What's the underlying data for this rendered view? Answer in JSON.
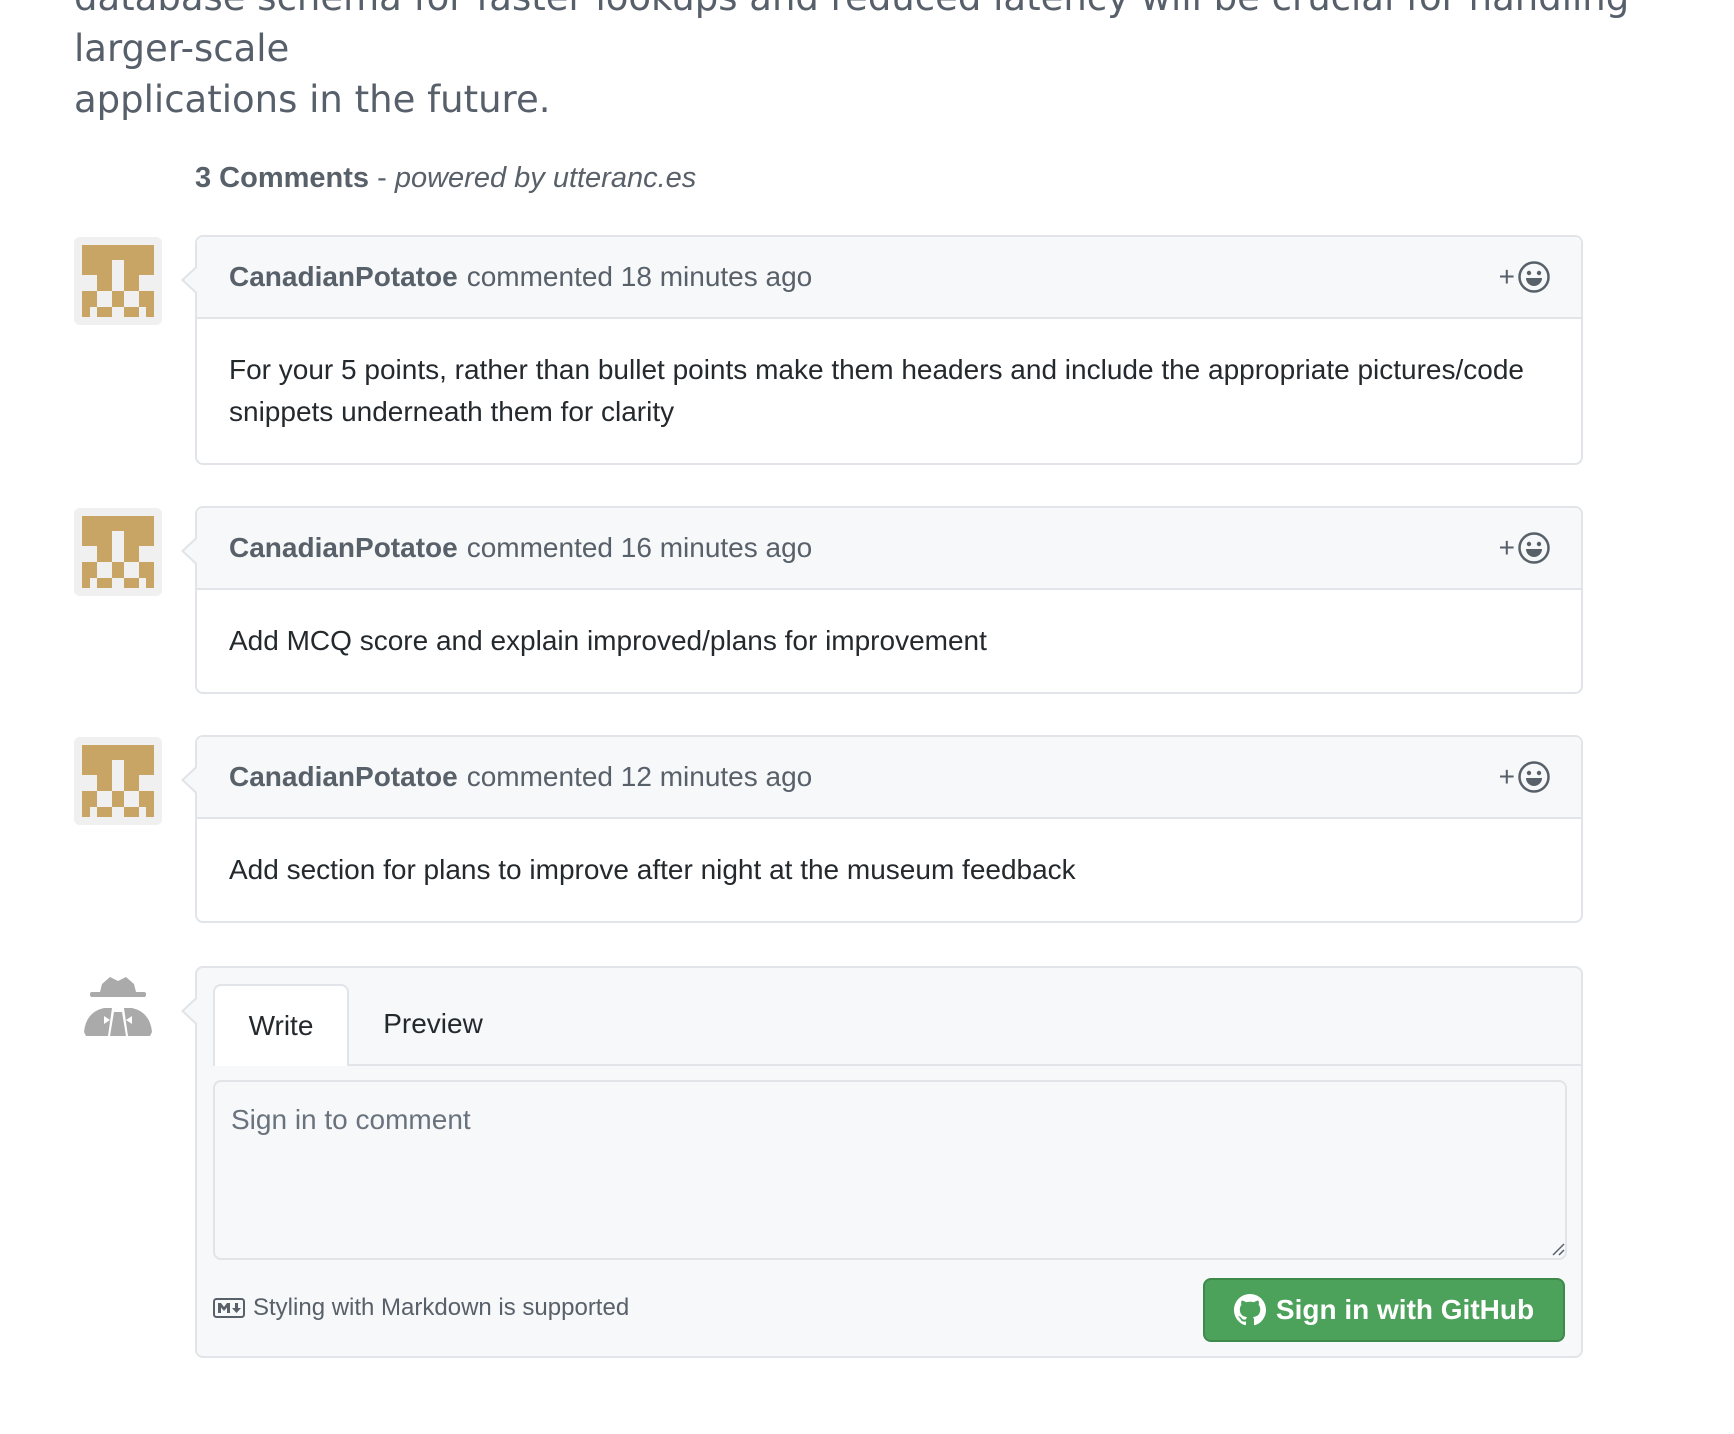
{
  "article": {
    "intro_line1": "database schema for faster lookups and reduced latency will be crucial for handling larger-scale",
    "intro_line2": "applications in the future."
  },
  "comments_header": {
    "count_label": "3 Comments",
    "separator": " - ",
    "powered_by": "powered by utteranc.es"
  },
  "comments": [
    {
      "author": "CanadianPotatoe",
      "action": "commented",
      "time": "18 minutes ago",
      "body": "For your 5 points, rather than bullet points make them headers and include the appropriate pictures/code snippets underneath them for clarity",
      "reaction_plus": "+"
    },
    {
      "author": "CanadianPotatoe",
      "action": "commented",
      "time": "16 minutes ago",
      "body": "Add MCQ score and explain improved/plans for improvement",
      "reaction_plus": "+"
    },
    {
      "author": "CanadianPotatoe",
      "action": "commented",
      "time": "12 minutes ago",
      "body": "Add section for plans to improve after night at the museum feedback",
      "reaction_plus": "+"
    }
  ],
  "new_comment": {
    "tab_write": "Write",
    "tab_preview": "Preview",
    "placeholder": "Sign in to comment",
    "markdown_hint": "Styling with Markdown is supported",
    "signin_label": "Sign in with GitHub"
  },
  "colors": {
    "avatar_identicon": "#c8a564",
    "signin_button": "#4ca25a",
    "border": "#e1e4e8",
    "header_bg": "#f6f8fa"
  },
  "icons": {
    "reaction": "smiley-icon",
    "markdown": "markdown-icon",
    "github": "github-mark-icon",
    "anonymous": "anonymous-user-icon"
  }
}
